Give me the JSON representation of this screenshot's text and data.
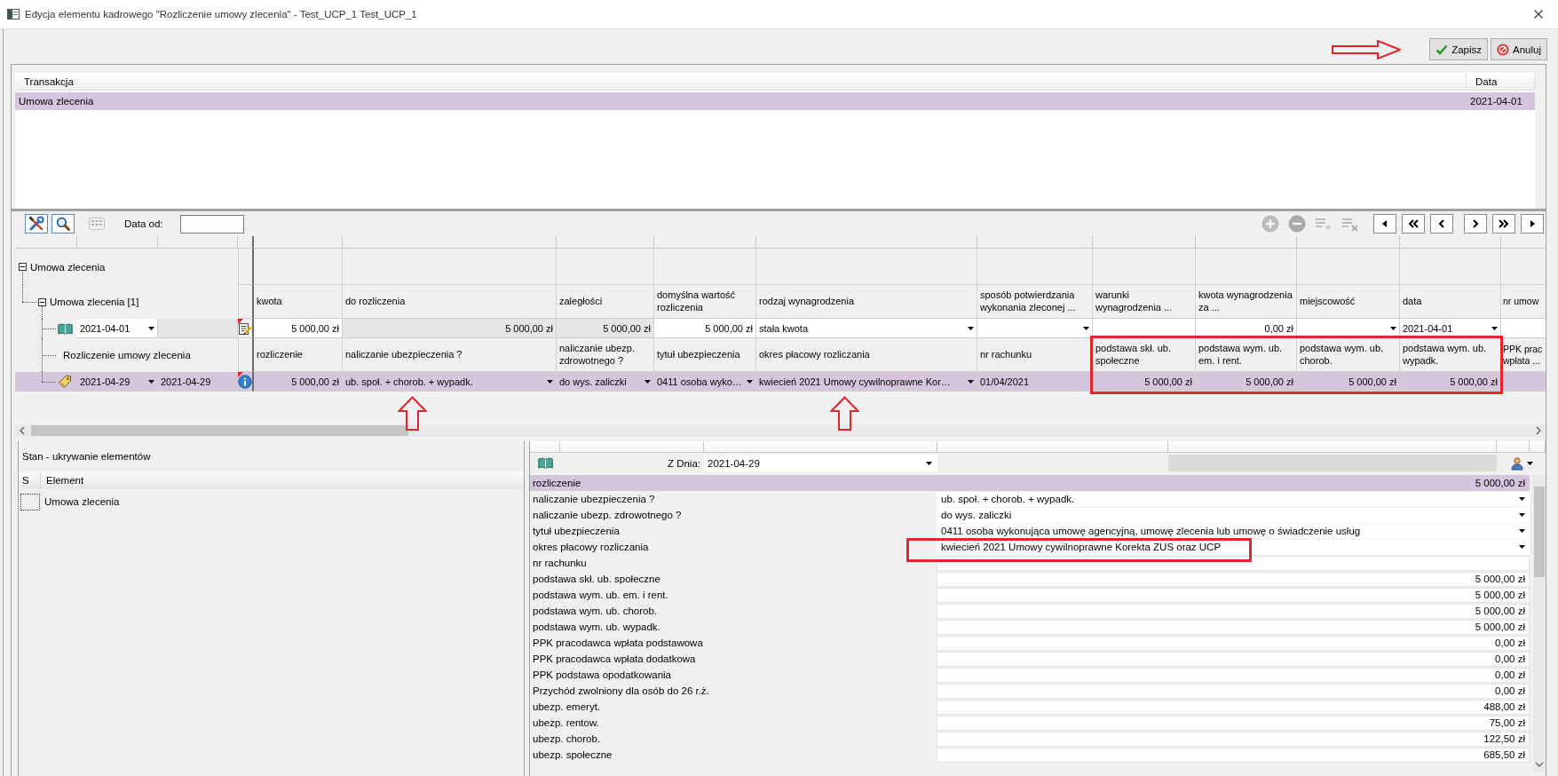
{
  "window": {
    "title": "Edycja elementu kadrowego \"Rozliczenie umowy zlecenia\" - Test_UCP_1 Test_UCP_1"
  },
  "actions": [
    {
      "kind": "save",
      "label": "Zapisz"
    },
    {
      "kind": "cancel",
      "label": "Anuluj"
    }
  ],
  "transactions": {
    "columns": [
      "Transakcja",
      "Data"
    ],
    "rows": [
      {
        "cells": [
          "Umowa zlecenia",
          "2021-04-01"
        ],
        "selected": true
      }
    ]
  },
  "toolbar": {
    "tools": [
      {
        "kind": "settings",
        "disabled": false
      },
      {
        "kind": "search",
        "disabled": false
      },
      {
        "kind": "counter",
        "disabled": true
      }
    ],
    "date_from": {
      "label": "Data od:"
    },
    "record_tools": [
      {
        "kind": "add",
        "disabled": true
      },
      {
        "kind": "remove",
        "disabled": true
      },
      {
        "kind": "mark",
        "disabled": true
      },
      {
        "kind": "unmark",
        "disabled": true
      }
    ]
  },
  "grid": {
    "tree": [
      {
        "kind": "group",
        "label": "Umowa zlecenia",
        "expanded": true,
        "children": [
          {
            "kind": "group",
            "label": "Umowa zlecenia [1]",
            "expanded": true,
            "columns": [
              "kwota",
              "do rozliczenia",
              "zaległości",
              "domyślna wartość rozliczenia",
              "rodzaj wynagrodzenia",
              "sposób potwierdzania wykonania zleconej ...",
              "warunki wynagrodzenia ...",
              "kwota wynagrodzenia za ...",
              "miejscowość",
              "data",
              "nr umow"
            ],
            "children": [
              {
                "kind": "agreement",
                "selected": false,
                "flagged": true,
                "date": {
                  "kind": "dropdown",
                  "value": "2021-04-01",
                  "readonly": false
                },
                "date_to": {
                  "kind": "text",
                  "readonly": true
                },
                "cells": [
                  {
                    "kind": "amount",
                    "value": "5 000,00 zł",
                    "readonly": false
                  },
                  {
                    "kind": "amount",
                    "value": "5 000,00 zł",
                    "readonly": true
                  },
                  {
                    "kind": "amount",
                    "value": "5 000,00 zł",
                    "readonly": true
                  },
                  {
                    "kind": "amount",
                    "value": "5 000,00 zł",
                    "readonly": false
                  },
                  {
                    "kind": "dropdown",
                    "value": "stała kwota",
                    "readonly": false
                  },
                  {
                    "kind": "dropdown",
                    "readonly": false
                  },
                  {
                    "kind": "text",
                    "readonly": false
                  },
                  {
                    "kind": "amount",
                    "value": "0,00 zł",
                    "readonly": false
                  },
                  {
                    "kind": "dropdown",
                    "readonly": false
                  },
                  {
                    "kind": "dropdown",
                    "value": "2021-04-01",
                    "readonly": false
                  },
                  {
                    "kind": "text",
                    "readonly": false
                  }
                ]
              },
              {
                "kind": "section",
                "label": "Rozliczenie umowy zlecenia",
                "columns": [
                  "rozliczenie",
                  "naliczanie ubezpieczenia ?",
                  "naliczanie ubezp. zdrowotnego ?",
                  "tytuł ubezpieczenia",
                  "okres płacowy rozliczania",
                  "nr rachunku",
                  "podstawa skł. ub. społeczne",
                  "podstawa wym. ub. em. i rent.",
                  "podstawa wym. ub. chorob.",
                  "podstawa wym. ub. wypadk.",
                  "PPK prac wpłata ..."
                ]
              },
              {
                "kind": "settlement",
                "selected": true,
                "flagged": true,
                "date": {
                  "kind": "dropdown",
                  "value": "2021-04-29"
                },
                "date_to": {
                  "kind": "text",
                  "value": "2021-04-29"
                },
                "cells": [
                  {
                    "kind": "amount",
                    "value": "5 000,00 zł"
                  },
                  {
                    "kind": "dropdown",
                    "value": "ub. społ. + chorob. + wypadk."
                  },
                  {
                    "kind": "dropdown",
                    "value": "do wys. zaliczki"
                  },
                  {
                    "kind": "dropdown",
                    "value": "0411 osoba wyko…"
                  },
                  {
                    "kind": "dropdown",
                    "value": "kwiecień 2021 Umowy cywilnoprawne Kor…"
                  },
                  {
                    "kind": "text",
                    "value": "01/04/2021"
                  },
                  {
                    "kind": "amount",
                    "value": "5 000,00 zł"
                  },
                  {
                    "kind": "amount",
                    "value": "5 000,00 zł"
                  },
                  {
                    "kind": "amount",
                    "value": "5 000,00 zł"
                  },
                  {
                    "kind": "amount",
                    "value": "5 000,00 zł"
                  },
                  {
                    "kind": "text"
                  }
                ]
              }
            ]
          }
        ]
      }
    ]
  },
  "hidden_elements": {
    "title": "Stan - ukrywanie elementów",
    "columns": [
      "S",
      "Element"
    ],
    "rows": [
      {
        "label": "Umowa zlecenia",
        "checked": false
      }
    ]
  },
  "details": {
    "date": {
      "label": "Z Dnia:",
      "value": "2021-04-29"
    },
    "fields": [
      {
        "label": "rozliczenie",
        "kind": "amount",
        "value": "5 000,00 zł",
        "selected": true
      },
      {
        "label": "naliczanie ubezpieczenia ?",
        "kind": "dropdown",
        "value": "ub. społ. + chorob. + wypadk.",
        "selected": false
      },
      {
        "label": "naliczanie ubezp. zdrowotnego ?",
        "kind": "dropdown",
        "value": "do wys. zaliczki",
        "selected": false
      },
      {
        "label": "tytuł ubezpieczenia",
        "kind": "dropdown",
        "value": "0411 osoba wykonująca umowę agencyjną, umowę zlecenia lub umowę o świadczenie usług",
        "selected": false
      },
      {
        "label": "okres płacowy rozliczania",
        "kind": "dropdown",
        "value": "kwiecień 2021 Umowy cywilnoprawne Korekta ZUS oraz UCP",
        "selected": false
      },
      {
        "label": "nr rachunku",
        "kind": "text",
        "selected": false
      },
      {
        "label": "podstawa skł. ub. społeczne",
        "kind": "amount",
        "value": "5 000,00 zł",
        "selected": false
      },
      {
        "label": "podstawa wym. ub. em. i rent.",
        "kind": "amount",
        "value": "5 000,00 zł",
        "selected": false
      },
      {
        "label": "podstawa wym. ub. chorob.",
        "kind": "amount",
        "value": "5 000,00 zł",
        "selected": false
      },
      {
        "label": "podstawa wym. ub. wypadk.",
        "kind": "amount",
        "value": "5 000,00 zł",
        "selected": false
      },
      {
        "label": "PPK pracodawca wpłata podstawowa",
        "kind": "amount",
        "value": "0,00 zł",
        "selected": false
      },
      {
        "label": "PPK pracodawca wpłata dodatkowa",
        "kind": "amount",
        "value": "0,00 zł",
        "selected": false
      },
      {
        "label": "PPK podstawa opodatkowania",
        "kind": "amount",
        "value": "0,00 zł",
        "selected": false
      },
      {
        "label": "Przychód zwolniony dla osób do 26 r.ż.",
        "kind": "amount",
        "value": "0,00 zł",
        "selected": false
      },
      {
        "label": "ubezp. emeryt.",
        "kind": "amount",
        "value": "488,00 zł",
        "selected": false
      },
      {
        "label": "ubezp. rentow.",
        "kind": "amount",
        "value": "75,00 zł",
        "selected": false
      },
      {
        "label": "ubezp. chorob.",
        "kind": "amount",
        "value": "122,50 zł",
        "selected": false
      },
      {
        "label": "ubezp. społeczne",
        "kind": "amount",
        "value": "685,50 zł",
        "selected": false
      }
    ]
  }
}
